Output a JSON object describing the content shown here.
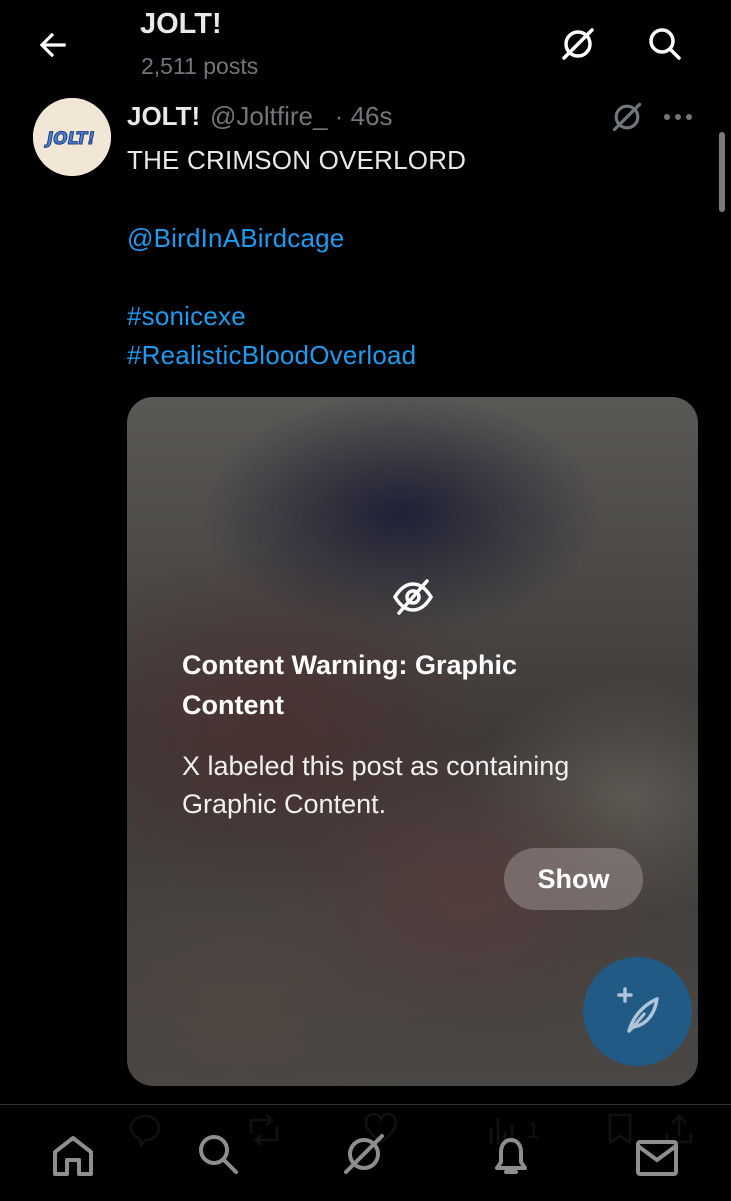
{
  "header": {
    "title": "JOLT!",
    "post_count": "2,511 posts"
  },
  "post": {
    "avatar_text": "JOLT!",
    "display_name": "JOLT!",
    "handle": "@Joltfire_",
    "separator": "·",
    "time": "46s",
    "lines": {
      "title": "THE CRIMSON OVERLORD",
      "mention": "@BirdInABirdcage",
      "tag1": "#sonicexe",
      "tag2": "#RealisticBloodOverload"
    },
    "media_warning": {
      "title": "Content Warning: Graphic Content",
      "body": "X labeled this post as containing Graphic Content.",
      "show_label": "Show"
    },
    "actions": {
      "views_count": "1"
    }
  },
  "colors": {
    "background": "#000000",
    "accent": "#1d9bf0",
    "muted": "#71767b",
    "text": "#e7e9ea"
  },
  "icons": [
    "back-arrow-icon",
    "grok-icon",
    "search-icon",
    "more-icon",
    "eye-slash-icon",
    "compose-icon",
    "reply-icon",
    "repost-icon",
    "like-icon",
    "views-icon",
    "bookmark-icon",
    "share-icon",
    "home-icon",
    "notifications-icon",
    "messages-icon"
  ]
}
